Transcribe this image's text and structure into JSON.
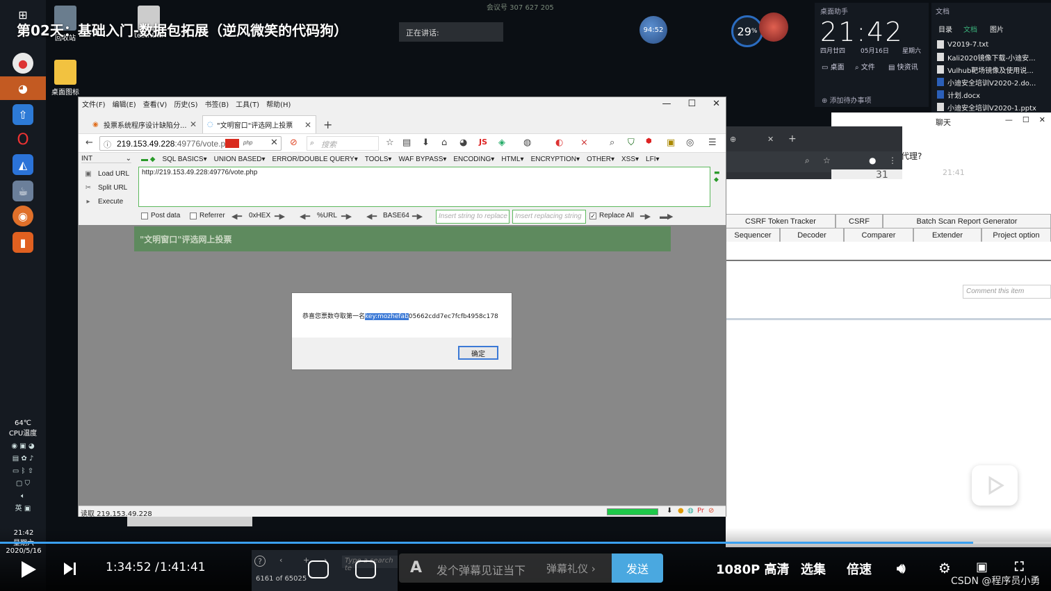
{
  "video": {
    "title": "第02天：基础入门-数据包拓展（逆风微笑的代码狗）",
    "time_current": "1:34:52",
    "time_separator": "/",
    "time_total": "1:41:41",
    "progress_fraction": 0.926,
    "danmu_placeholder": "发个弹幕见证当下",
    "danmu_gift": "弹幕礼仪 ›",
    "danmu_a": "A",
    "send_label": "发送",
    "quality_label": "1080P 高清",
    "episodes_label": "选集",
    "speed_label": "倍速",
    "watermark": "CSDN @程序员小勇"
  },
  "meeting": {
    "id_text": "会议号 307 627 205",
    "speaking_label": "正在讲话:",
    "timer": "94:52",
    "weather_temp": "29"
  },
  "clock_widget": {
    "title": "桌面助手",
    "time": "21:42",
    "lunar": "四月廿四",
    "date": "05月16日",
    "weekday": "星期六",
    "row1": [
      "桌面",
      "文件",
      "快资讯"
    ],
    "add_todo": "添加待办事项"
  },
  "docs_panel": {
    "title": "文档",
    "tabs": [
      "目录",
      "文档",
      "图片"
    ],
    "items": [
      {
        "name": "V2019-7.txt",
        "type": "txt"
      },
      {
        "name": "Kali2020镜像下载-小迪安...",
        "type": "txt"
      },
      {
        "name": "Vulhub靶场镜像及使用说...",
        "type": "txt"
      },
      {
        "name": "小迪安全培训V2020-2.do...",
        "type": "word"
      },
      {
        "name": "计划.docx",
        "type": "word"
      },
      {
        "name": "小迪安全培训V2020-1.pptx",
        "type": "txt"
      }
    ]
  },
  "desktop": {
    "icons": [
      {
        "label": "回收站"
      },
      {
        "label": "testhtml"
      },
      {
        "label": "桌面图标"
      }
    ]
  },
  "chat": {
    "title": "聊天",
    "question": "代理?",
    "time": "21:41",
    "number": "31"
  },
  "burp": {
    "tabs_row1": [
      "CSRF Token Tracker",
      "CSRF",
      "Batch Scan Report Generator"
    ],
    "tabs_row2": [
      "Sequencer",
      "Decoder",
      "Comparer",
      "Extender",
      "Project option"
    ],
    "comment_placeholder": "Comment this item"
  },
  "firefox": {
    "menu": [
      "文件(F)",
      "编辑(E)",
      "查看(V)",
      "历史(S)",
      "书签(B)",
      "工具(T)",
      "帮助(H)"
    ],
    "tabs": [
      {
        "label": "投票系统程序设计缺陷分...",
        "active": false
      },
      {
        "label": "\"文明窗口\"评选网上投票",
        "active": true
      }
    ],
    "url_host": "219.153.49.228",
    "url_path": ":49776/vote.p",
    "url_badge": "php",
    "search_placeholder": "搜索",
    "js_badge": "JS",
    "status_text": "读取 219.153.49.228"
  },
  "hackbar": {
    "select_value": "INT",
    "menu": [
      "SQL BASICS▾",
      "UNION BASED▾",
      "ERROR/DOUBLE QUERY▾",
      "TOOLS▾",
      "WAF BYPASS▾",
      "ENCODING▾",
      "HTML▾",
      "ENCRYPTION▾",
      "OTHER▾",
      "XSS▾",
      "LFI▾"
    ],
    "load_url": "Load URL",
    "split_url": "Split URL",
    "execute": "Execute",
    "url_value": "http://219.153.49.228:49776/vote.php",
    "post_data": "Post data",
    "referrer": "Referrer",
    "hex": "0xHEX",
    "urlenc": "%URL",
    "base64": "BASE64",
    "insert_replace": "Insert string to replace",
    "insert_replacing": "Insert replacing string",
    "replace_all": "Replace All"
  },
  "page": {
    "banner": "\"文明窗口\"评选网上投票"
  },
  "alert": {
    "msg_prefix": "恭喜您票数夺取第一名",
    "msg_selected": "key:mozhefab",
    "msg_suffix": "05662cdd7ec7fcfb4958c178",
    "ok_label": "确定"
  },
  "system": {
    "cpu_temp": "64℃",
    "cpu_label": "CPU温度",
    "ime": "英",
    "time": "21:42",
    "weekday": "星期六",
    "date": "2020/5/16"
  },
  "bottom_mid": {
    "count": "6161 of 65025",
    "search_placeholder": "Type a search te"
  },
  "colors": {
    "accent": "#3aa0f0",
    "send": "#4aa8e0",
    "hackbar_border": "#5cb85c",
    "banner": "#5e8a5e",
    "selection": "#3b79d6"
  }
}
